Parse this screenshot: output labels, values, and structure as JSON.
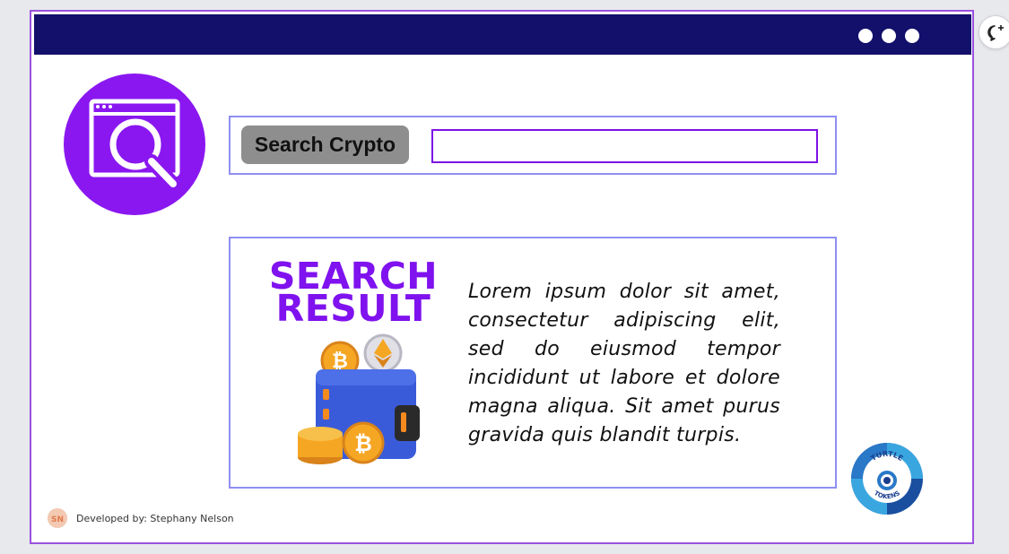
{
  "search": {
    "label": "Search Crypto",
    "input_value": ""
  },
  "result": {
    "title_line1": "SEARCH",
    "title_line2": "RESULT",
    "body": "Lorem ipsum dolor sit amet, consectetur adipiscing elit, sed do eiusmod tempor incididunt ut labore et dolore magna aliqua. Sit amet purus gravida quis blandit turpis."
  },
  "footer": {
    "avatar_initials": "SN",
    "credit": "Developed by: Stephany Nelson"
  },
  "logo": {
    "text_top": "TURTLE",
    "text_bottom": "TOKENS"
  },
  "icons": {
    "window_dots": "three-dot-icon",
    "search_logo": "browser-search-icon",
    "wallet": "crypto-wallet-icon",
    "chat": "add-comment-icon"
  },
  "colors": {
    "topbar": "#13106b",
    "accent_purple": "#8a17f0",
    "box_border": "#8f8ff2",
    "label_bg": "#8e8e8e"
  }
}
